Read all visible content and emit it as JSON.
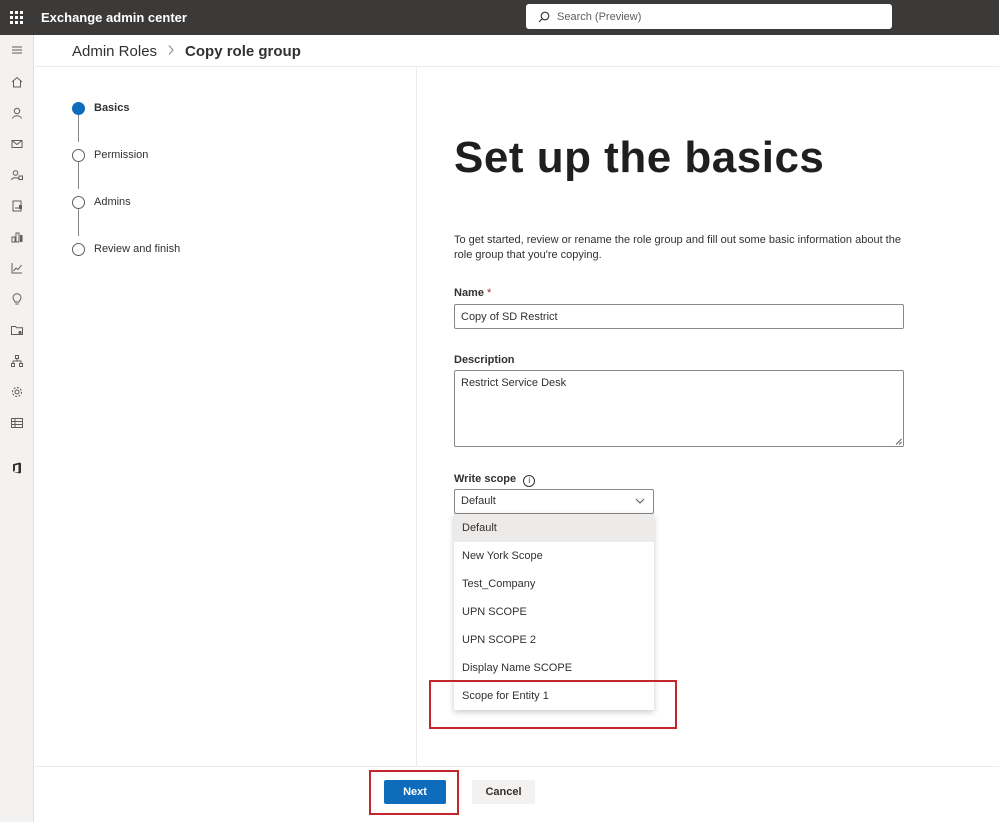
{
  "app": {
    "title": "Exchange admin center"
  },
  "search": {
    "placeholder": "Search (Preview)"
  },
  "rail": {
    "icons": [
      "hamburger-menu-icon",
      "home-icon",
      "person-icon",
      "mail-icon",
      "people-icon",
      "report-icon",
      "org-chart-icon",
      "chart-icon",
      "lightbulb-icon",
      "folder-settings-icon",
      "hierarchy-icon",
      "gear-icon",
      "table-icon",
      "office-logo-icon"
    ]
  },
  "breadcrumb": {
    "parent": "Admin Roles",
    "current": "Copy role group"
  },
  "steps": [
    {
      "label": "Basics",
      "active": true
    },
    {
      "label": "Permission",
      "active": false
    },
    {
      "label": "Admins",
      "active": false
    },
    {
      "label": "Review and finish",
      "active": false
    }
  ],
  "form": {
    "title": "Set up the basics",
    "intro": "To get started, review or rename the role group and fill out some basic information about the role group that you're copying.",
    "name_label": "Name",
    "required_mark": "*",
    "name_value": "Copy of SD Restrict",
    "description_label": "Description",
    "description_value": "Restrict Service Desk",
    "write_scope_label": "Write scope",
    "info_glyph": "i",
    "write_scope_value": "Default",
    "write_scope_options": [
      "Default",
      "New York Scope",
      "Test_Company",
      "UPN SCOPE",
      "UPN SCOPE 2",
      "Display Name SCOPE",
      "Scope for Entity 1"
    ]
  },
  "footer": {
    "next_label": "Next",
    "cancel_label": "Cancel"
  },
  "colors": {
    "accent": "#0f6cbd",
    "topbar": "#3b3a39",
    "highlight": "#c4262e"
  }
}
